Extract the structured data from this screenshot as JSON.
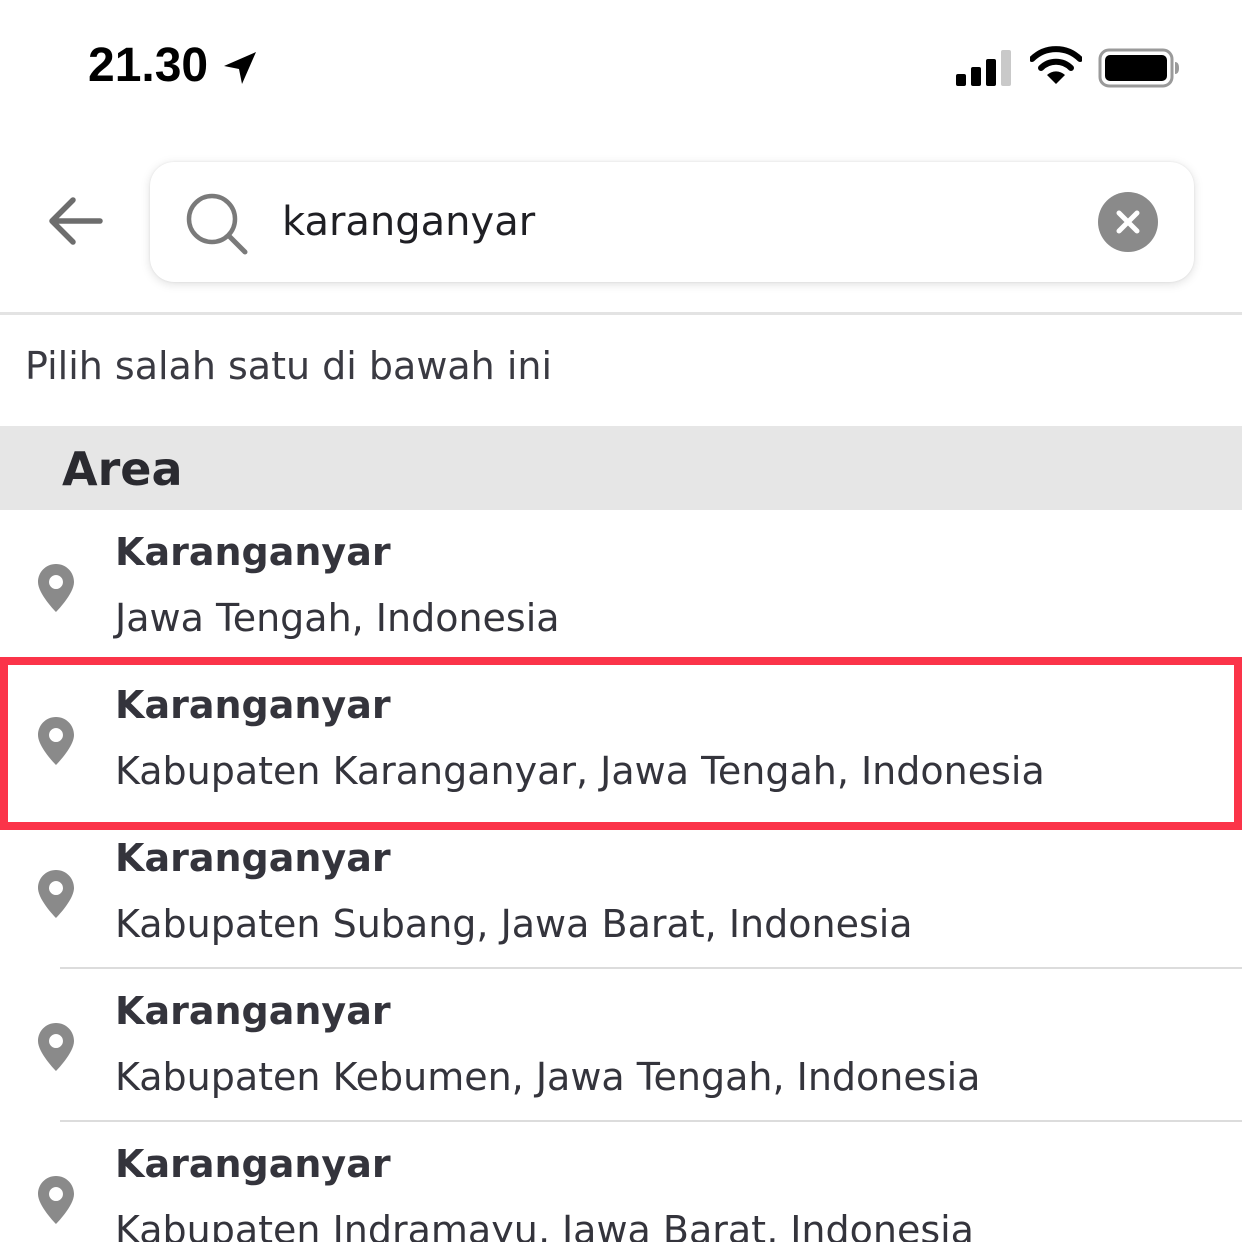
{
  "status_bar": {
    "time": "21.30",
    "location_icon": "location-arrow-icon",
    "signal_icon": "cellular-signal-icon",
    "wifi_icon": "wifi-icon",
    "battery_icon": "battery-icon"
  },
  "search": {
    "back_icon": "back-arrow-icon",
    "search_icon": "search-icon",
    "value": "karanganyar",
    "clear_icon": "clear-icon"
  },
  "hint": "Pilih salah satu di bawah ini",
  "section": {
    "title": "Area"
  },
  "results": [
    {
      "title": "Karanganyar",
      "subtitle": "Jawa Tengah, Indonesia",
      "highlighted": false
    },
    {
      "title": "Karanganyar",
      "subtitle": "Kabupaten Karanganyar, Jawa Tengah, Indonesia",
      "highlighted": true
    },
    {
      "title": "Karanganyar",
      "subtitle": "Kabupaten Subang, Jawa Barat, Indonesia",
      "highlighted": false
    },
    {
      "title": "Karanganyar",
      "subtitle": "Kabupaten Kebumen, Jawa Tengah, Indonesia",
      "highlighted": false
    },
    {
      "title": "Karanganyar",
      "subtitle": "Kabupaten Indramayu, Jawa Barat, Indonesia",
      "highlighted": false
    }
  ],
  "colors": {
    "highlight": "#fb3449",
    "icon_gray": "#8a8a8a",
    "section_bg": "#e6e6e6"
  }
}
